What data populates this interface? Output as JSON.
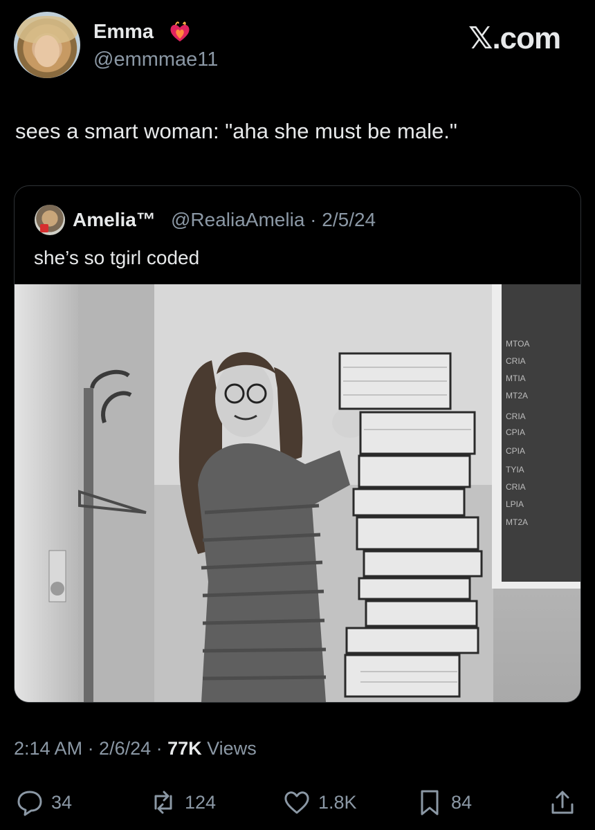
{
  "author": {
    "name": "Emma",
    "handle": "@emmmae11",
    "badge_icon": "heart-on-fire-icon",
    "avatar": "profile-photo"
  },
  "brand": "𝕏.com",
  "tweet": {
    "text": "sees a smart woman: \"aha she must be male.\""
  },
  "quoted": {
    "name": "Amelia™",
    "handle_date": "@RealiaAmelia · 2/5/24",
    "text": "she’s so tgirl coded",
    "image": "black-and-white photo: woman with glasses standing next to a tall stack of printed code listings"
  },
  "meta": {
    "time_date": "2:14 AM · 2/6/24 · ",
    "views_count": "77K",
    "views_label": " Views"
  },
  "actions": {
    "replies": "34",
    "reposts": "124",
    "likes": "1.8K",
    "bookmarks": "84"
  },
  "colors": {
    "background": "#000000",
    "text": "#e7e9ea",
    "muted": "#8b98a5",
    "border": "#2f3336",
    "heart": "#e0245e"
  }
}
